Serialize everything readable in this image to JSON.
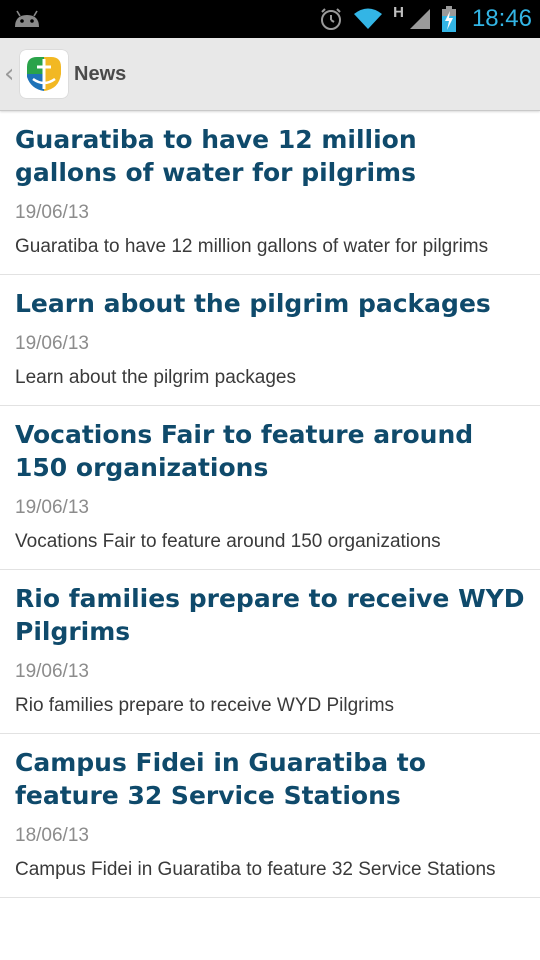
{
  "status_bar": {
    "time": "18:46",
    "network_label": "H",
    "icons": [
      "android-debug-icon",
      "alarm-icon",
      "wifi-icon",
      "signal-icon",
      "battery-charging-icon"
    ],
    "accent_color": "#33b5e5"
  },
  "action_bar": {
    "title": "News",
    "up_icon": "chevron-left-icon",
    "logo_icon": "wyd-logo-icon"
  },
  "news": [
    {
      "title": "Guaratiba to have 12 million gallons of water for pilgrims",
      "date": "19/06/13",
      "summary": "Guaratiba to have 12 million gallons of water for pilgrims"
    },
    {
      "title": "Learn about the pilgrim packages",
      "date": "19/06/13",
      "summary": "Learn about the pilgrim packages"
    },
    {
      "title": "Vocations Fair to feature around 150 organizations",
      "date": "19/06/13",
      "summary": "Vocations Fair to feature around 150 organizations"
    },
    {
      "title": "Rio families prepare to receive WYD Pilgrims",
      "date": "19/06/13",
      "summary": "Rio families prepare to receive WYD Pilgrims"
    },
    {
      "title": "Campus Fidei in Guaratiba to feature 32 Service Stations",
      "date": "18/06/13",
      "summary": "Campus Fidei in Guaratiba to feature 32 Service Stations"
    }
  ],
  "colors": {
    "title": "#0f4a6b",
    "date": "#8c8c8c",
    "summary": "#3a3a3a",
    "action_bar_bg": "#e8e8e8"
  }
}
